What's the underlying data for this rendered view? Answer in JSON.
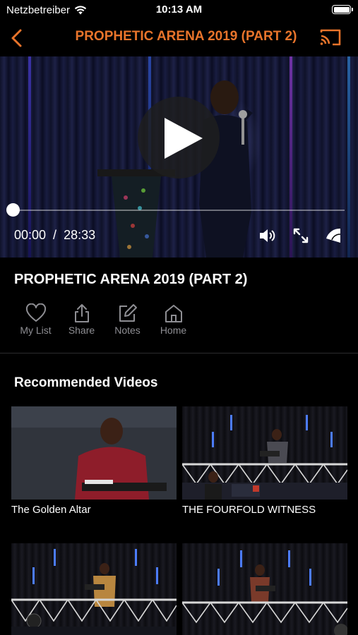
{
  "status_bar": {
    "carrier": "Netzbetreiber",
    "time": "10:13 AM"
  },
  "nav": {
    "title": "PROPHETIC ARENA 2019 (PART 2)",
    "accent_color": "#e8742b",
    "back_icon": "chevron-left-icon",
    "cast_icon": "cast-icon"
  },
  "player": {
    "current_time": "00:00",
    "separator": "/",
    "duration": "28:33",
    "progress": 0.0
  },
  "video_title": "PROPHETIC ARENA 2019 (PART 2)",
  "actions": [
    {
      "label": "My List",
      "icon": "heart-icon"
    },
    {
      "label": "Share",
      "icon": "share-icon"
    },
    {
      "label": "Notes",
      "icon": "edit-icon"
    },
    {
      "label": "Home",
      "icon": "home-icon"
    }
  ],
  "recommended": {
    "heading": "Recommended Videos",
    "items": [
      {
        "title": "The Golden Altar"
      },
      {
        "title": "THE FOURFOLD WITNESS"
      },
      {
        "title": ""
      },
      {
        "title": ""
      }
    ]
  }
}
